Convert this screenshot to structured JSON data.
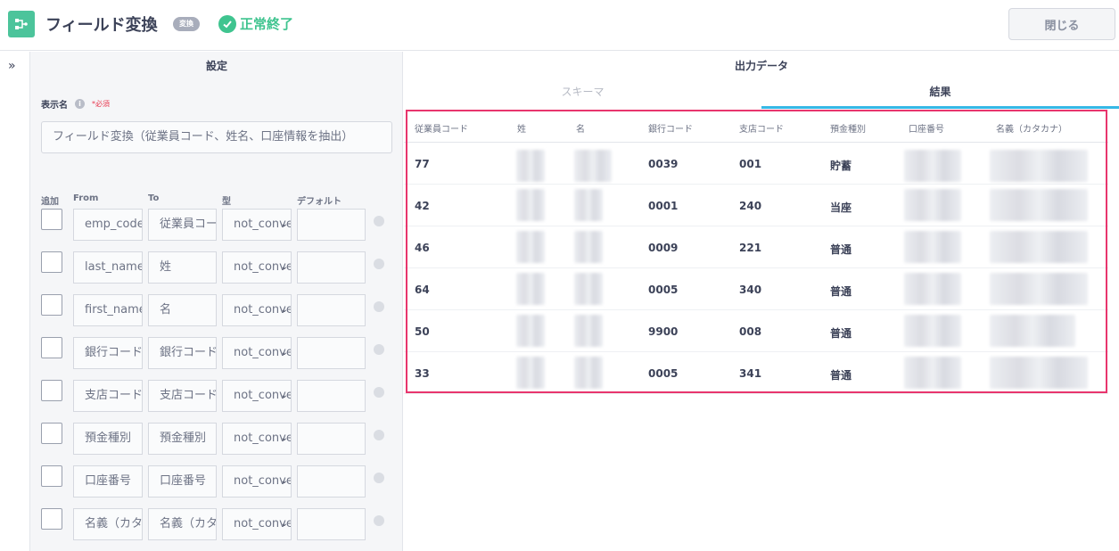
{
  "header": {
    "title": "フィールド変換",
    "badge": "変換",
    "status": "正常終了",
    "close_label": "閉じる"
  },
  "settings": {
    "title": "設定",
    "display_name_label": "表示名",
    "required_label": "*必須",
    "display_name_value": "フィールド変換（従業員コード、姓名、口座情報を抽出）",
    "columns": {
      "add": "追加",
      "from": "From",
      "to": "To",
      "type": "型",
      "default": "デフォルト"
    },
    "mappings": [
      {
        "from": "emp_code",
        "to": "従業員コード",
        "type": "not_convert",
        "default": ""
      },
      {
        "from": "last_name",
        "to": "姓",
        "type": "not_convert",
        "default": ""
      },
      {
        "from": "first_name",
        "to": "名",
        "type": "not_convert",
        "default": ""
      },
      {
        "from": "銀行コード",
        "to": "銀行コード",
        "type": "not_convert",
        "default": ""
      },
      {
        "from": "支店コード",
        "to": "支店コード",
        "type": "not_convert",
        "default": ""
      },
      {
        "from": "預金種別",
        "to": "預金種別",
        "type": "not_convert",
        "default": ""
      },
      {
        "from": "口座番号",
        "to": "口座番号",
        "type": "not_convert",
        "default": ""
      },
      {
        "from": "名義（カタカナ）",
        "to": "名義（カタカナ）",
        "type": "not_convert",
        "default": ""
      }
    ]
  },
  "output": {
    "title": "出力データ",
    "tabs": {
      "schema": "スキーマ",
      "result": "結果"
    },
    "columns": [
      "従業員コード",
      "姓",
      "名",
      "銀行コード",
      "支店コード",
      "預金種別",
      "口座番号",
      "名義（カタカナ）"
    ],
    "rows": [
      {
        "emp": "77",
        "bank": "0039",
        "branch": "001",
        "kind": "貯蓄"
      },
      {
        "emp": "42",
        "bank": "0001",
        "branch": "240",
        "kind": "当座"
      },
      {
        "emp": "46",
        "bank": "0009",
        "branch": "221",
        "kind": "普通"
      },
      {
        "emp": "64",
        "bank": "0005",
        "branch": "340",
        "kind": "普通"
      },
      {
        "emp": "50",
        "bank": "9900",
        "branch": "008",
        "kind": "普通"
      },
      {
        "emp": "33",
        "bank": "0005",
        "branch": "341",
        "kind": "普通"
      }
    ]
  }
}
